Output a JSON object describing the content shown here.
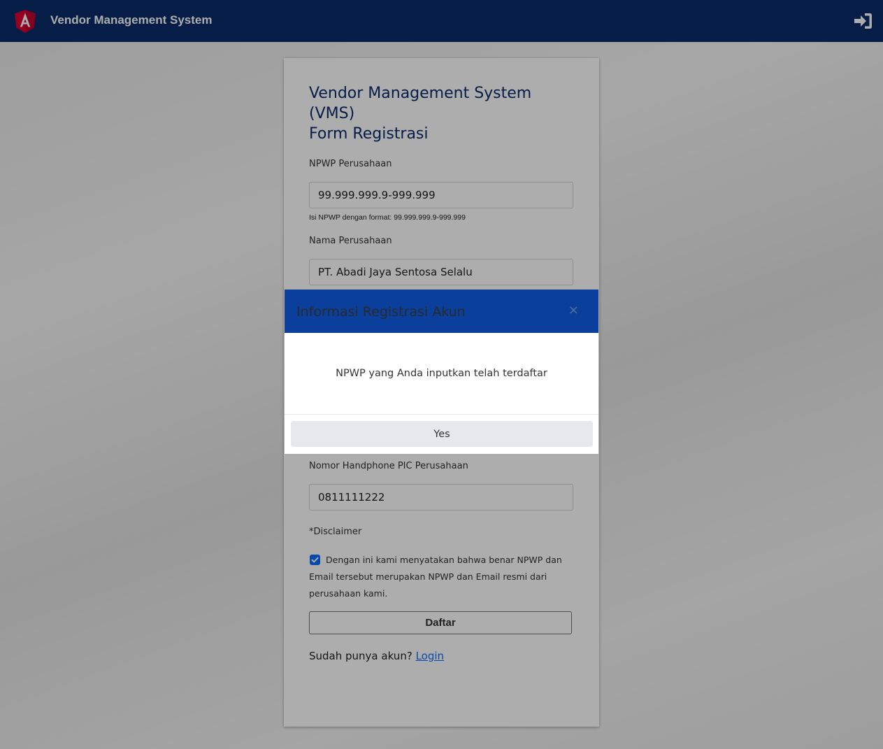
{
  "navbar": {
    "title": "Vendor Management System",
    "logo_icon": "angular-logo-icon",
    "login_icon": "sign-in-icon",
    "background": "#0a2b6b"
  },
  "form": {
    "title_line1": "Vendor Management System (VMS)",
    "title_line2": "Form Registrasi",
    "npwp_label": "NPWP Perusahaan",
    "npwp_value": "99.999.999.9-999.999",
    "npwp_help": "Isi NPWP dengan format: 99.999.999.9-999.999",
    "company_label": "Nama Perusahaan",
    "company_value": "PT. Abadi Jaya Sentosa Selalu",
    "phone_label": "Nomor Handphone PIC Perusahaan",
    "phone_value": "0811111222",
    "disclaimer_label": "*Disclaimer",
    "disclaimer_checked": true,
    "disclaimer_text": "Dengan ini kami menyatakan bahwa benar NPWP dan Email tersebut merupakan NPWP dan Email resmi dari perusahaan kami.",
    "submit_label": "Daftar",
    "already_text": "Sudah punya akun?",
    "login_link": "Login"
  },
  "modal": {
    "title": "Informasi Registrasi Akun",
    "close_symbol": "×",
    "message": "NPWP yang Anda inputkan telah terdaftar",
    "yes_label": "Yes",
    "header_color": "#0a3f9c"
  }
}
